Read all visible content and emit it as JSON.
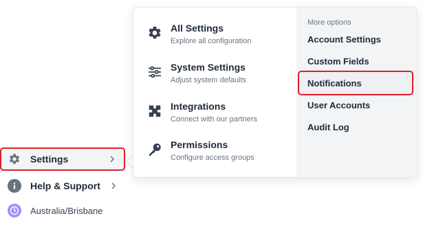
{
  "sidebar": {
    "items": [
      {
        "label": "Settings",
        "icon": "gear-icon"
      },
      {
        "label": "Help & Support",
        "icon": "info-icon"
      },
      {
        "label": "Australia/Brisbane",
        "icon": "clock-icon"
      }
    ]
  },
  "flyout": {
    "main": [
      {
        "title": "All Settings",
        "description": "Explore all configuration",
        "icon": "gear-icon"
      },
      {
        "title": "System Settings",
        "description": "Adjust system defaults",
        "icon": "sliders-icon"
      },
      {
        "title": "Integrations",
        "description": "Connect with our partners",
        "icon": "puzzle-icon"
      },
      {
        "title": "Permissions",
        "description": "Configure access groups",
        "icon": "key-icon"
      }
    ],
    "more": {
      "heading": "More options",
      "items": [
        "Account Settings",
        "Custom Fields",
        "Notifications",
        "User Accounts",
        "Audit Log"
      ]
    }
  },
  "colors": {
    "highlight_border": "#e11d2b",
    "info_icon_bg": "#6b7280",
    "clock_icon_bg": "#a78bfa"
  }
}
